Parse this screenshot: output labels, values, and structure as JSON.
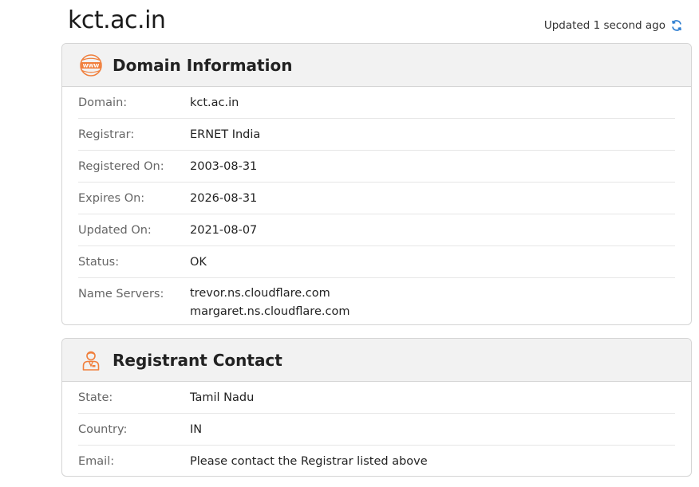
{
  "header": {
    "domain": "kct.ac.in",
    "updated_text": "Updated 1 second ago"
  },
  "domain_info": {
    "title": "Domain Information",
    "icon": "www-globe-icon",
    "rows": [
      {
        "label": "Domain:",
        "value": "kct.ac.in"
      },
      {
        "label": "Registrar:",
        "value": "ERNET India"
      },
      {
        "label": "Registered On:",
        "value": "2003-08-31"
      },
      {
        "label": "Expires On:",
        "value": "2026-08-31"
      },
      {
        "label": "Updated On:",
        "value": "2021-08-07"
      },
      {
        "label": "Status:",
        "value": "OK"
      }
    ],
    "name_servers": {
      "label": "Name Servers:",
      "values": [
        "trevor.ns.cloudflare.com",
        "margaret.ns.cloudflare.com"
      ]
    }
  },
  "registrant": {
    "title": "Registrant Contact",
    "icon": "person-icon",
    "rows": [
      {
        "label": "State:",
        "value": "Tamil Nadu"
      },
      {
        "label": "Country:",
        "value": "IN"
      },
      {
        "label": "Email:",
        "value": "Please contact the Registrar listed above"
      }
    ]
  },
  "colors": {
    "accent_orange": "#f07f3c",
    "refresh_blue": "#2f7fd1",
    "header_bg": "#f2f2f2",
    "border": "#d5d5d5"
  }
}
